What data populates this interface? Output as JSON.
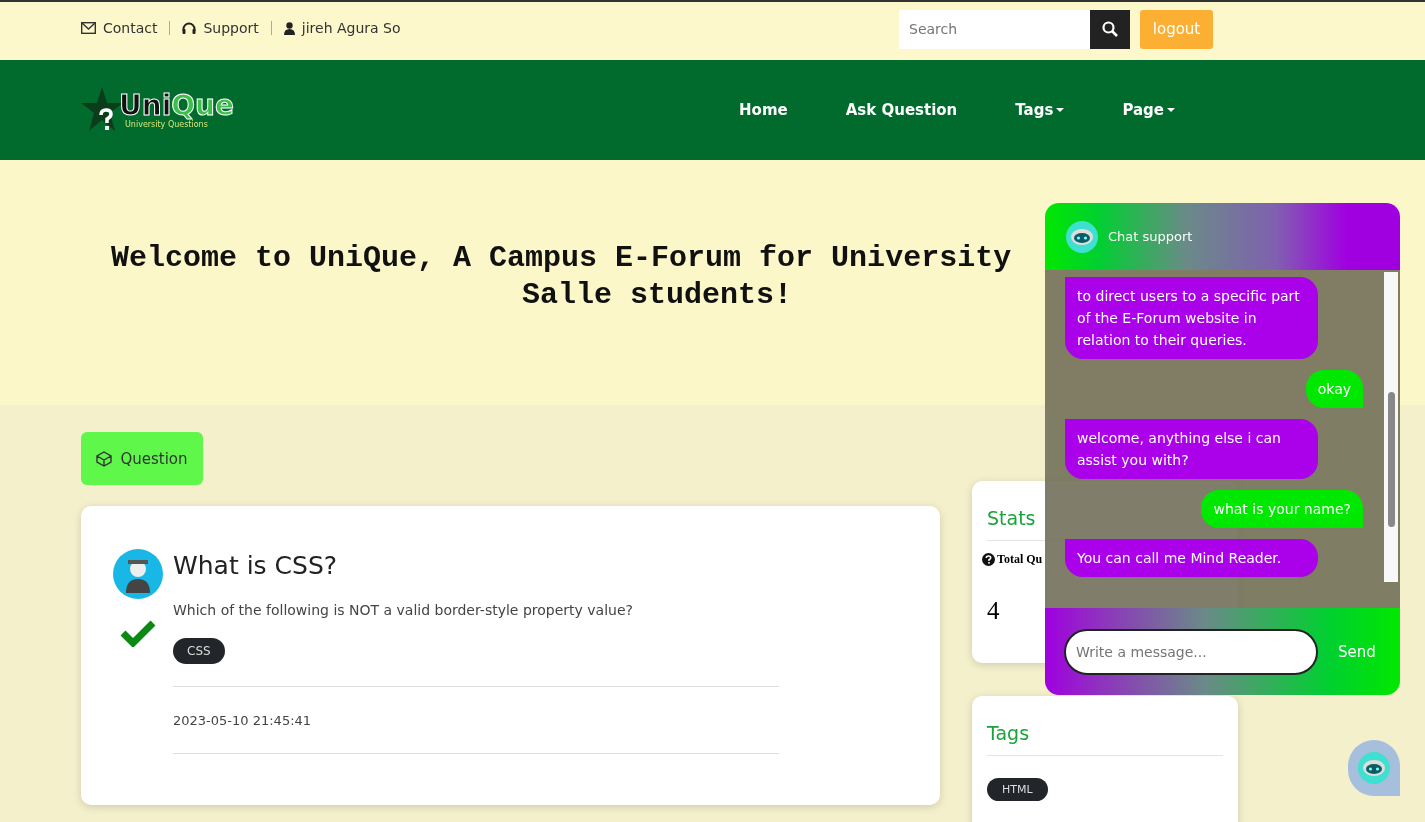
{
  "top_bar": {
    "links": [
      {
        "label": "Contact",
        "kind": "mail"
      },
      {
        "label": "Support",
        "kind": "headset"
      },
      {
        "label": "jireh Agura So",
        "kind": "user"
      }
    ],
    "search": {
      "placeholder": "Search"
    },
    "logout": "logout"
  },
  "navbar": {
    "logo": {
      "title_dark": "Uni",
      "title_light": "Que",
      "subtitle": "University Questions"
    },
    "items": [
      {
        "label": "Home",
        "dropdown": false
      },
      {
        "label": "Ask Question",
        "dropdown": false
      },
      {
        "label": "Tags",
        "dropdown": true
      },
      {
        "label": "Page",
        "dropdown": true
      }
    ]
  },
  "hero": {
    "line_1": "Welcome to UniQue, A Campus E-Forum for University",
    "line_2": "Salle students!"
  },
  "question_button": "Question",
  "question": {
    "title": "What is CSS?",
    "body": "Which of the following is NOT a valid border-style property value?",
    "tags": [
      "CSS"
    ],
    "answered": true,
    "date": "2023-05-10 21:45:41"
  },
  "stats": {
    "title": "Stats",
    "label": "Total Qu",
    "value": "4"
  },
  "tags_card": {
    "title": "Tags",
    "tags": [
      "HTML"
    ]
  },
  "chat": {
    "title": "Chat support",
    "messages": [
      {
        "kind": "bot",
        "text": "to direct users to a specific part of the E-Forum website in relation to their queries."
      },
      {
        "kind": "user",
        "text": "okay"
      },
      {
        "kind": "bot",
        "text": "welcome, anything else i can assist you with?"
      },
      {
        "kind": "user",
        "text": "what is your name?"
      },
      {
        "kind": "bot",
        "text": "You can call me Mind Reader."
      }
    ],
    "placeholder": "Write a message...",
    "send": "Send"
  }
}
